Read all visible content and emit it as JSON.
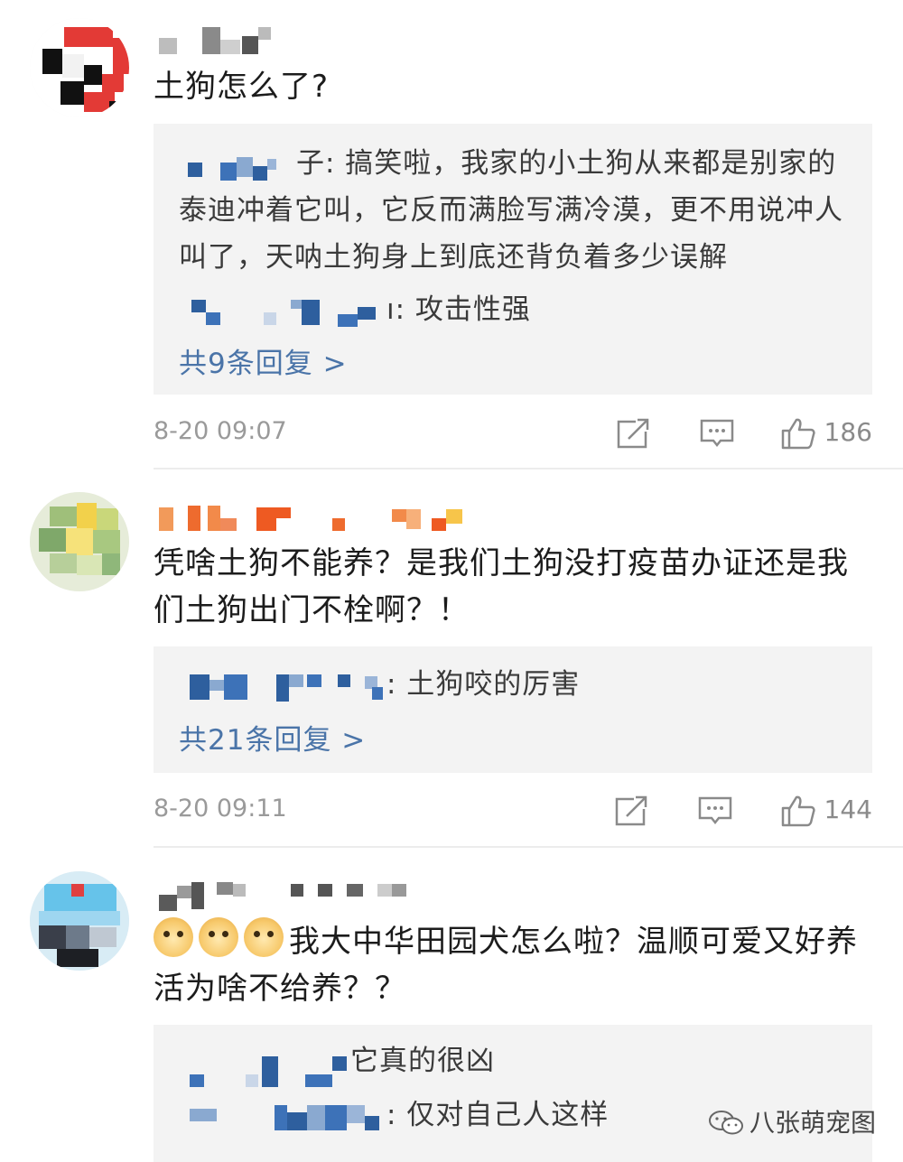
{
  "comments": [
    {
      "text": "土狗怎么了?",
      "replies": [
        {
          "text": "子: 搞笑啦，我家的小土狗从来都是别家的泰迪冲着它叫，它反而满脸写满冷漠，更不用说冲人叫了，天呐土狗身上到底还背负着多少误解"
        },
        {
          "text": "ı: 攻击性强"
        }
      ],
      "more": "共9条回复 >",
      "time": "8-20 09:07",
      "likes": "186"
    },
    {
      "text": "凭啥土狗不能养？是我们土狗没打疫苗办证还是我们土狗出门不栓啊？！",
      "replies": [
        {
          "text": ": 土狗咬的厉害"
        }
      ],
      "more": "共21条回复 >",
      "time": "8-20 09:11",
      "likes": "144"
    },
    {
      "text": "我大中华田园犬怎么啦？温顺可爱又好养活为啥不给养？？",
      "emoji_count": 3,
      "replies": [
        {
          "text": "它真的很凶"
        },
        {
          "text": ": 仅对自己人这样"
        }
      ]
    }
  ],
  "icons": {
    "share": "share-icon",
    "comment": "comment-icon",
    "like": "thumbs-up-icon",
    "emoji": "doge-emoji-icon"
  },
  "watermark": "八张萌宠图",
  "colors": {
    "link": "#4a74a8",
    "reply_bg": "#f3f3f3",
    "meta": "#9a9a9a"
  }
}
